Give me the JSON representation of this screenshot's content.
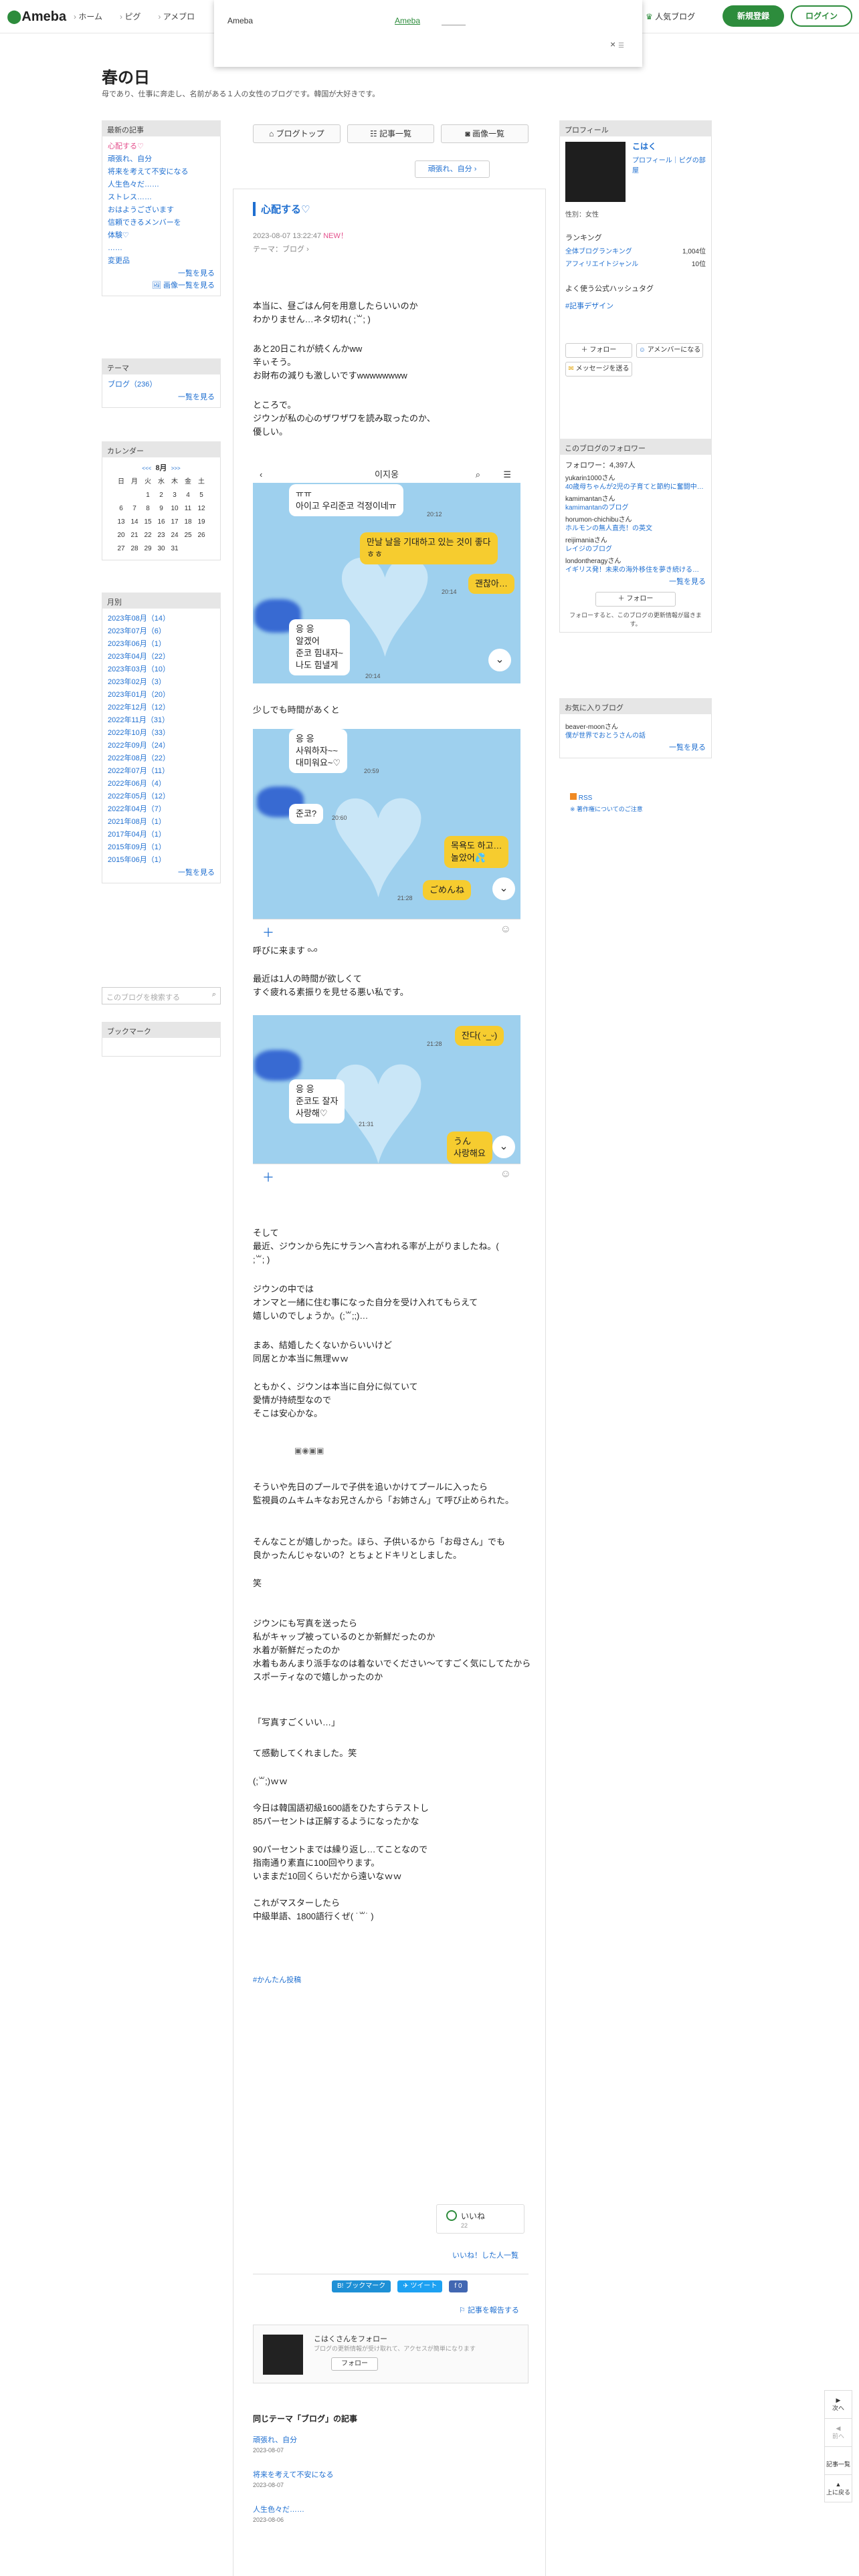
{
  "header": {
    "logo": "Ameba",
    "nav": [
      "ホーム",
      "ピグ",
      "アメブロ"
    ],
    "popular": "人気ブログ",
    "signup": "新規登録",
    "login": "ログイン"
  },
  "ad": {
    "label": "Ameba",
    "link": "Ameba",
    "close": "×"
  },
  "blog": {
    "title": "春の日",
    "desc": "母であり、仕事に奔走し、名前がある１人の女性のブログです。韓国が大好きです。"
  },
  "recent": {
    "head": "最新の記事",
    "items": [
      "心配する♡",
      "頑張れ、自分",
      "将来を考えて不安になる",
      "人生色々だ……",
      "ストレス……",
      "おはようございます",
      "信頼できるメンバーを",
      "体験♡",
      "……",
      "変更品"
    ],
    "more": "一覧を見る",
    "more_img": "画像一覧を見る"
  },
  "theme": {
    "head": "テーマ",
    "items": [
      "ブログ（236）"
    ],
    "more": "一覧を見る"
  },
  "calendar": {
    "head": "カレンダー",
    "month": "8月",
    "prev": "<<<",
    "next": ">>>",
    "dow": [
      "日",
      "月",
      "火",
      "水",
      "木",
      "金",
      "土"
    ],
    "weeks": [
      [
        "",
        "",
        "1",
        "2",
        "3",
        "4",
        "5"
      ],
      [
        "6",
        "7",
        "8",
        "9",
        "10",
        "11",
        "12"
      ],
      [
        "13",
        "14",
        "15",
        "16",
        "17",
        "18",
        "19"
      ],
      [
        "20",
        "21",
        "22",
        "23",
        "24",
        "25",
        "26"
      ],
      [
        "27",
        "28",
        "29",
        "30",
        "31",
        "",
        ""
      ]
    ]
  },
  "monthly": {
    "head": "月別",
    "items": [
      "2023年08月（14）",
      "2023年07月（6）",
      "2023年06月（1）",
      "2023年04月（22）",
      "2023年03月（10）",
      "2023年02月（3）",
      "2023年01月（20）",
      "2022年12月（12）",
      "2022年11月（31）",
      "2022年10月（33）",
      "2022年09月（24）",
      "2022年08月（22）",
      "2022年07月（11）",
      "2022年06月（4）",
      "2022年05月（12）",
      "2022年04月（7）",
      "2021年08月（1）",
      "2017年04月（1）",
      "2015年09月（1）",
      "2015年06月（1）"
    ],
    "more": "一覧を見る"
  },
  "search": {
    "placeholder": "このブログを検索する"
  },
  "bookmark": {
    "head": "ブックマーク"
  },
  "tabs": [
    "ブログトップ",
    "記事一覧",
    "画像一覧"
  ],
  "themetag": "頑張れ、自分",
  "article": {
    "title": "心配する♡",
    "date": "2023-08-07 13:22:47",
    "new": "NEW！",
    "theme": "テーマ：ブログ",
    "p1": "本当に、昼ごはん何を用意したらいいのか\nわかりません…ネタ切れ( ;꒳; )",
    "p2": "あと20日これが続くんかww\n辛ぃそう。\nお財布の減りも激しいですwwwwwwww",
    "p3": "ところで。\nジウンが私の心のザワザワを読み取ったのか、\n優しい。",
    "p4": "少しでも時間があくと",
    "p5": "呼びに来ます ᵒᵕᵒ",
    "p6": "最近は1人の時間が欲しくて\nすぐ疲れる素振りを見せる悪い私です。",
    "p7": "そして\n最近、ジウンから先にサランヘ言われる率が上がりましたね。( \n;꒳; )",
    "p8": "ジウンの中では\nオンマと一緒に住む事になった自分を受け入れてもらえて\n嬉しいのでしょうか。(;꒳;;)…",
    "p9": "まあ、結婚したくないからいいけど\n同居とか本当に無理ｗｗ",
    "p10": "ともかく、ジウンは本当に自分に似ていて\n愛情が持続型なので\nそこは安心かな。",
    "brokenimgs": "▣◉▣▣",
    "p11": "そういや先日のプールで子供を追いかけてプールに入ったら\n監視員のムキムキなお兄さんから「お姉さん」て呼び止められた。",
    "p12": "そんなことが嬉しかった。ほら、子供いるから「お母さん」でも\n良かったんじゃないの？とちょとドキリとしました。",
    "p13": "笑",
    "p14": "ジウンにも写真を送ったら\n私がキャップ被っているのとか新鮮だったのか\n水着が新鮮だったのか\n水着もあんまり派手なのは着ないでください〜てすごく気にしてたから\nスポーティなので嬉しかったのか",
    "p15": "「写真すごくいい…」",
    "p16": "て感動してくれました。笑",
    "p17": "(;꒳;)ｗｗ",
    "p18": "今日は韓国語初級1600語をひたすらテストし\n85パーセントは正解するようになったかな",
    "p19": "90パーセントまでは繰り返し…てことなので\n指南通り素直に100回やります。\nいままだ10回くらいだから遠いなｗｗ",
    "p20": "これがマスターしたら\n中級単語、1800語行くぜ( ˙꒳˙ )"
  },
  "chat1": {
    "header": "이지웅",
    "b1": "ㅠㅠ\n아이고 우리준코 걱정이네ㅠ",
    "t1": "20:12",
    "b2": "만날 날을 기대하고 있는 것이 좋다\nㅎㅎ",
    "t2": "20:14",
    "b3": "괜찮아…",
    "b4": "응 응\n알겠어\n준코 힘내자~\n나도 힘낼게",
    "t4": "20:14"
  },
  "chat2": {
    "b1": "응 응\n사워하자~~\n대미워요~♡",
    "t1": "20:59",
    "b2": "준코?",
    "t2": "20:60",
    "b3": "목욕도 하고…\n놀았어💦",
    "b4": "ごめんね",
    "t4": "21:28"
  },
  "chat3": {
    "b1": "잔다( ᵕ_ᵕ)",
    "t1": "21:28",
    "b2": "응 응\n준코도 잘자\n사랑해♡",
    "t2": "21:31",
    "b3": "うん\n사랑해요"
  },
  "hashtag": "#かんたん投稿",
  "like": {
    "label": "いいね",
    "count": "22",
    "likedby": "いいね！した人一覧"
  },
  "share": {
    "bookmark": "B! ブックマーク",
    "tweet": "ツイート",
    "fb": "f 0"
  },
  "report": "記事を報告する",
  "follow": {
    "t1": "こはくさんをフォロー",
    "t2": "ブログの更新情報が受け取れて、アクセスが簡単になります",
    "btn": "フォロー"
  },
  "sametheme": {
    "head": "同じテーマ「ブログ」の記事",
    "items": [
      {
        "title": "頑張れ、自分",
        "date": "2023-08-07"
      },
      {
        "title": "将来を考えて不安になる",
        "date": "2023-08-07"
      },
      {
        "title": "人生色々だ……",
        "date": "2023-08-06"
      }
    ]
  },
  "profile": {
    "head": "プロフィール",
    "name": "こはく",
    "links": "プロフィール｜ピグの部屋",
    "sex": "性別：女性",
    "ranking": "ランキング",
    "r1": "全体ブログランキング",
    "r1v": "1,004位",
    "r2": "アフィリエイトジャンル",
    "r2v": "10位",
    "hashhead": "よく使う公式ハッシュタグ",
    "hash": "#記事デザイン",
    "follow": "＋ フォロー",
    "amember": "アメンバーになる",
    "msg": "メッセージを送る"
  },
  "followers": {
    "head": "このブログのフォロワー",
    "count": "フォロワー：4,397人",
    "items": [
      {
        "n": "yukarin1000さん",
        "b": "40歳母ちゃんが2児の子育てと節約に奮闘中！…"
      },
      {
        "n": "kamimantanさん",
        "b": "kamimantanのブログ"
      },
      {
        "n": "horumon-chichibuさん",
        "b": "ホルモンの無人直売！の英文"
      },
      {
        "n": "reijimaniaさん",
        "b": "レイジのブログ"
      },
      {
        "n": "londontheragyさん",
        "b": "イギリス発！未来の海外移住を夢き続ける…"
      }
    ],
    "more": "一覧を見る",
    "btn": "＋ フォロー",
    "note": "フォローすると、このブログの更新情報が届きます。"
  },
  "favblog": {
    "head": "お気に入りブログ",
    "n": "beaver-moonさん",
    "b": "僕が世界でおとうさんの話",
    "more": "一覧を見る"
  },
  "rss": {
    "label": "RSS",
    "note": "※ 著作権についてのご注意"
  },
  "floatnav": [
    "次へ",
    "前へ",
    "記事一覧",
    "上に戻る"
  ],
  "colors": {
    "ameba_green": "#2d8c3c",
    "link": "#1f6fd0",
    "chat_bg": "#9ed0ee",
    "bubble_yellow": "#f6cc2f"
  }
}
